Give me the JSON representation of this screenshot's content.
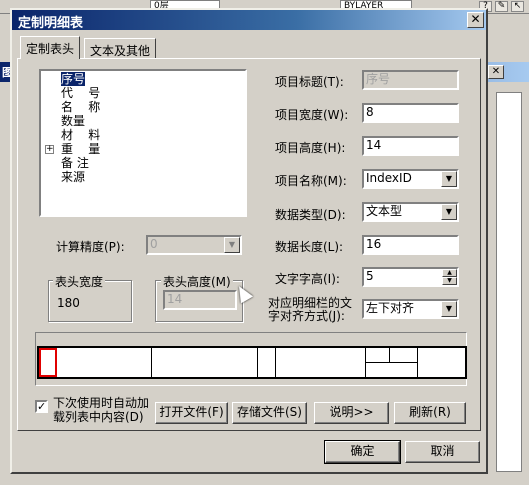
{
  "background": {
    "combo1": "0层",
    "combo2": "BYLAYER",
    "window_title": "图",
    "side_icons": [
      "?",
      "✎",
      "↖"
    ]
  },
  "dialog": {
    "title": "定制明细表",
    "close": "✕"
  },
  "tabs": [
    {
      "label": "定制表头",
      "active": true
    },
    {
      "label": "文本及其他",
      "active": false
    }
  ],
  "tree": {
    "items": [
      {
        "label": "序号",
        "selected": true
      },
      {
        "label": "代    号",
        "selected": false
      },
      {
        "label": "名    称",
        "selected": false
      },
      {
        "label": "数量",
        "selected": false
      },
      {
        "label": "材    料",
        "selected": false
      },
      {
        "label": "重    量",
        "selected": false,
        "expandable": true
      },
      {
        "label": "备 注",
        "selected": false
      },
      {
        "label": "来源",
        "selected": false
      }
    ],
    "expand_symbol": "+"
  },
  "fields": {
    "item_title": {
      "label": "项目标题(T):",
      "value": "序号"
    },
    "item_width": {
      "label": "项目宽度(W):",
      "value": "8"
    },
    "item_height": {
      "label": "项目高度(H):",
      "value": "14"
    },
    "item_name": {
      "label": "项目名称(M):",
      "value": "IndexID"
    },
    "data_type": {
      "label": "数据类型(D):",
      "value": "文本型"
    },
    "data_length": {
      "label": "数据长度(L):",
      "value": "16"
    },
    "text_height": {
      "label": "文字字高(I):",
      "value": "5"
    },
    "align_line1": "对应明细栏的文",
    "align_line2": "字对齐方式(J):",
    "align_value": "左下对齐",
    "precision": {
      "label": "计算精度(P):",
      "value": "0"
    }
  },
  "header_width": {
    "label": "表头宽度",
    "value": "180"
  },
  "header_height": {
    "label": "表头高度(M)",
    "value": "14"
  },
  "auto_load": {
    "line1": "下次使用时自动加",
    "line2": "载列表中内容(D)",
    "checked": true,
    "check_mark": "✓"
  },
  "buttons": {
    "open_file": "打开文件(F)",
    "save_file": "存储文件(S)",
    "explain": "说明>>",
    "refresh": "刷新(R)",
    "ok": "确定",
    "cancel": "取消"
  },
  "glyphs": {
    "dropdown": "▼",
    "spin_up": "▲",
    "spin_down": "▼"
  }
}
